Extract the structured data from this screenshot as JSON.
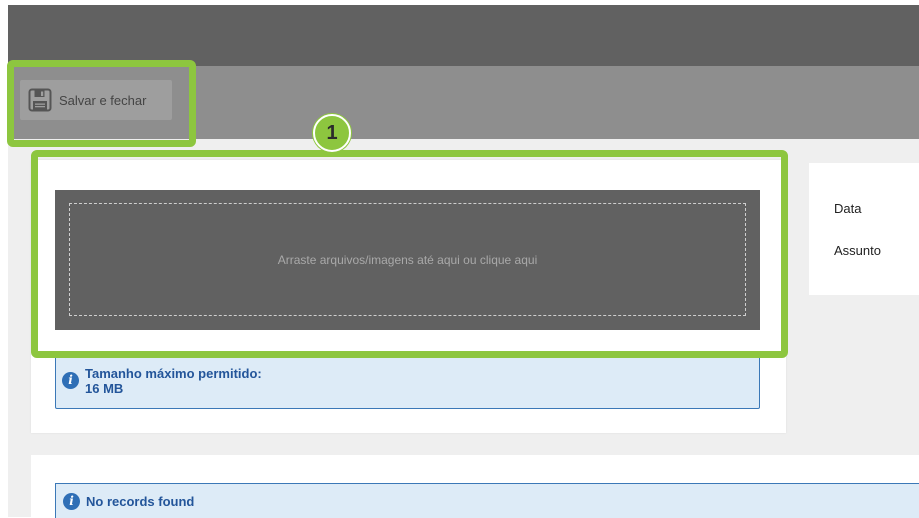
{
  "toolbar": {
    "save_label": "Salvar e fechar"
  },
  "upload": {
    "drop_text": "Arraste arquivos/imagens até aqui ou clique aqui",
    "max_size_label": "Tamanho máximo permitido:",
    "max_size_value": "16 MB"
  },
  "side_panel": {
    "fields": [
      "Data",
      "Assunto"
    ]
  },
  "records": {
    "empty_message": "No records found"
  },
  "annotation": {
    "step_number": "1",
    "highlight_color": "#8dc63f"
  },
  "icons": {
    "save": "floppy-disk-icon",
    "info": "info-icon"
  },
  "colors": {
    "topbar": "#616161",
    "toolbar": "#8e8e8e",
    "drop_zone": "#616161",
    "info_bg": "#ddebf7",
    "info_text": "#23559a"
  }
}
